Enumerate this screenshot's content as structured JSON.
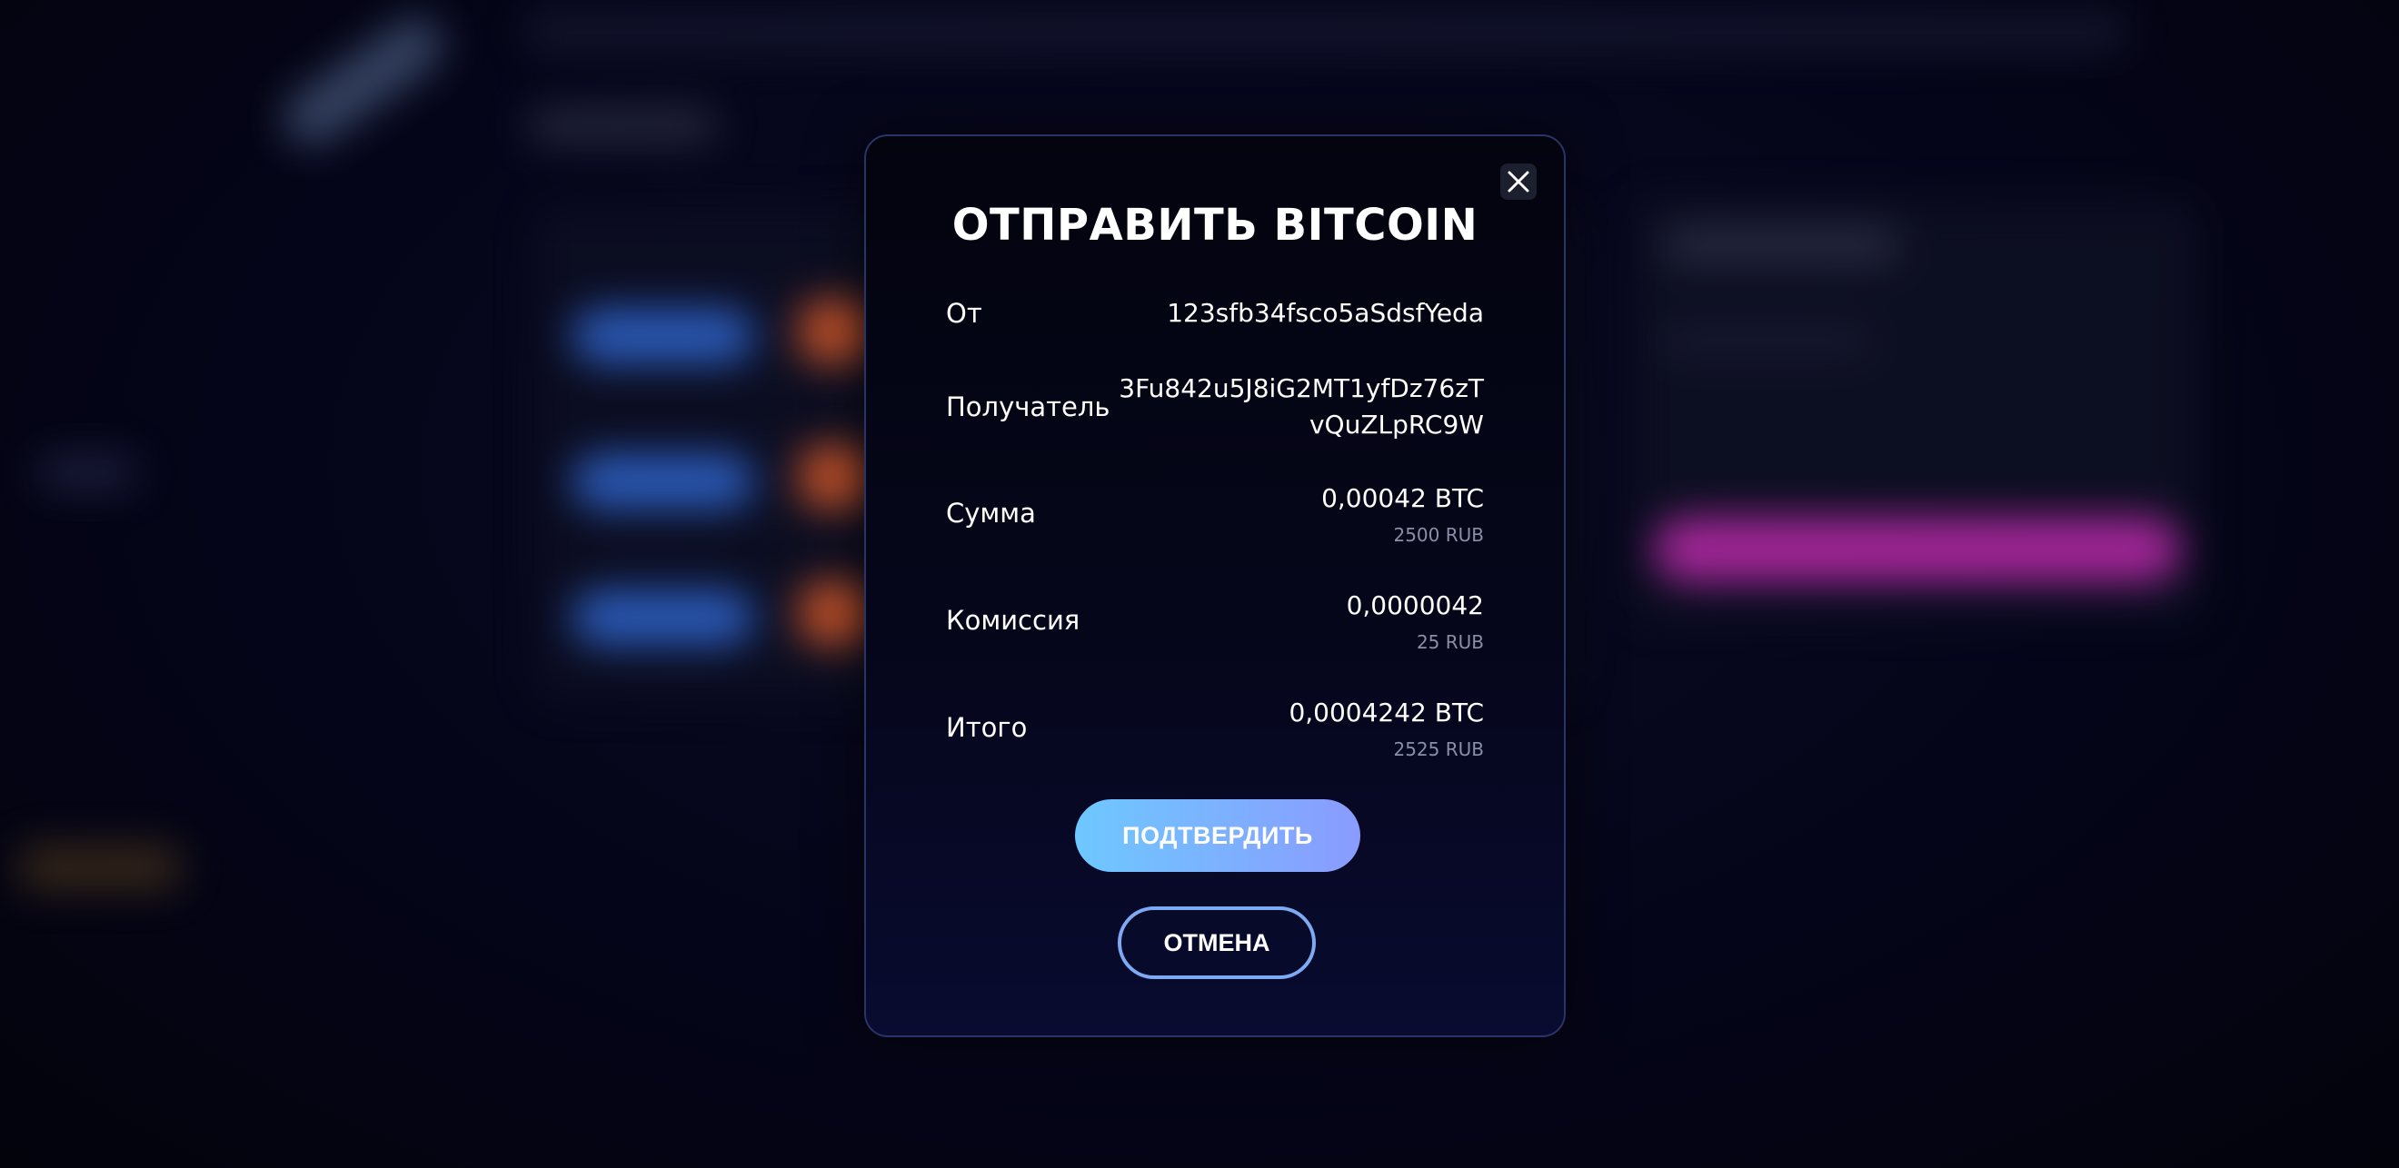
{
  "modal": {
    "title": "ОТПРАВИТЬ BITCOIN",
    "close_icon": "close-icon",
    "rows": {
      "from": {
        "label": "От",
        "value": "123sfb34fsco5aSdsfYeda"
      },
      "recipient": {
        "label": "Получатель",
        "value": "3Fu842u5J8iG2MT1yfDz76zTvQuZLpRC9W"
      },
      "amount": {
        "label": "Сумма",
        "value": "0,00042 BTC",
        "sub": "2500 RUB"
      },
      "fee": {
        "label": "Комиссия",
        "value": "0,0000042",
        "sub": "25 RUB"
      },
      "total": {
        "label": "Итого",
        "value": "0,0004242 BTC",
        "sub": "2525 RUB"
      }
    },
    "confirm_label": "ПОДТВЕРДИТЬ",
    "cancel_label": "ОТМЕНА"
  },
  "colors": {
    "confirm_gradient_start": "#6ec8ff",
    "confirm_gradient_end": "#8a9bff",
    "cancel_border": "#7eaaf4",
    "modal_border": "#2a3466"
  }
}
